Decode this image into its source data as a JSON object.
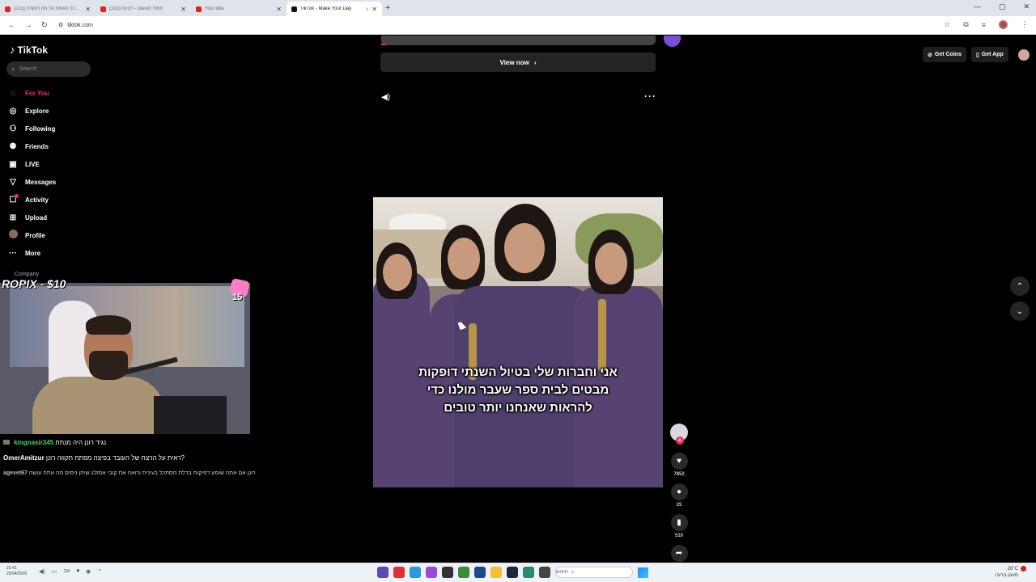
{
  "browser": {
    "tabs": [
      {
        "title": "(213) כל האמת על מה חוקרת…",
        "favicon": "yt"
      },
      {
        "title": "(313) חמוד מגושם - רוניוס",
        "favicon": "yt"
      },
      {
        "title": "YouTube",
        "favicon": "yt"
      },
      {
        "title": "TikTok - Make Your Day",
        "favicon": "tt",
        "active": true
      }
    ],
    "url": "tiktok.com",
    "new_tab_glyph": "+",
    "window_controls": [
      "—",
      "▢",
      "✕"
    ]
  },
  "tiktok": {
    "logo_text": "TikTok",
    "search_placeholder": "Search",
    "nav": [
      {
        "label": "For You",
        "icon": "home-icon",
        "glyph": "⌂",
        "active": true
      },
      {
        "label": "Explore",
        "icon": "compass-icon",
        "glyph": "◎"
      },
      {
        "label": "Following",
        "icon": "user-follow-icon",
        "glyph": "⚇"
      },
      {
        "label": "Friends",
        "icon": "friends-icon",
        "glyph": "⚉"
      },
      {
        "label": "LIVE",
        "icon": "live-icon",
        "glyph": "▣"
      },
      {
        "label": "Messages",
        "icon": "messages-icon",
        "glyph": "▽"
      },
      {
        "label": "Activity",
        "icon": "activity-icon",
        "glyph": "☐"
      },
      {
        "label": "Upload",
        "icon": "upload-icon",
        "glyph": "⊞"
      },
      {
        "label": "Profile",
        "icon": "profile-avatar",
        "glyph": ""
      },
      {
        "label": "More",
        "icon": "more-icon",
        "glyph": "···"
      }
    ],
    "company_label": "Company",
    "view_now_label": "View now",
    "subtitles": [
      "אני וחברות שלי בטיול השנתי דופקות",
      "מבטים לבית ספר שעבר מולנו כדי",
      "להראות שאנחנו יותר טובים"
    ],
    "actions": {
      "likes": "7852",
      "comments": "25",
      "saves": "510"
    },
    "top_right": {
      "get_coins": "Get Coins",
      "get_app": "Get App"
    }
  },
  "stream": {
    "overlay_text": "ROPIX - $10",
    "sticker_text": "15",
    "chat": [
      {
        "user": "kingnasir345",
        "user_color": "#3ed66a",
        "message": "נגיד רונן היה מנתח"
      },
      {
        "user": "OmerAmitzur",
        "user_color": "#ffffff",
        "message": "ראית על הרצח של העובד בפיצה מפתח תקווה רונן?"
      },
      {
        "user": "agevet67",
        "user_color": "#bbbbbb",
        "message": "רונן אם אתה שומע דפיקות בדלת מסתכל בעינית ורואה את קובי אמזלג שיחן ניסים מה אתה עושה"
      }
    ]
  },
  "taskbar": {
    "time": "22:42",
    "date": "25/04/2026",
    "search_placeholder": "חיפוש",
    "weather": "20°C",
    "weather_sub": "מעונן ברובו"
  },
  "colors": {
    "accent": "#fe2c55",
    "background": "#000000"
  }
}
